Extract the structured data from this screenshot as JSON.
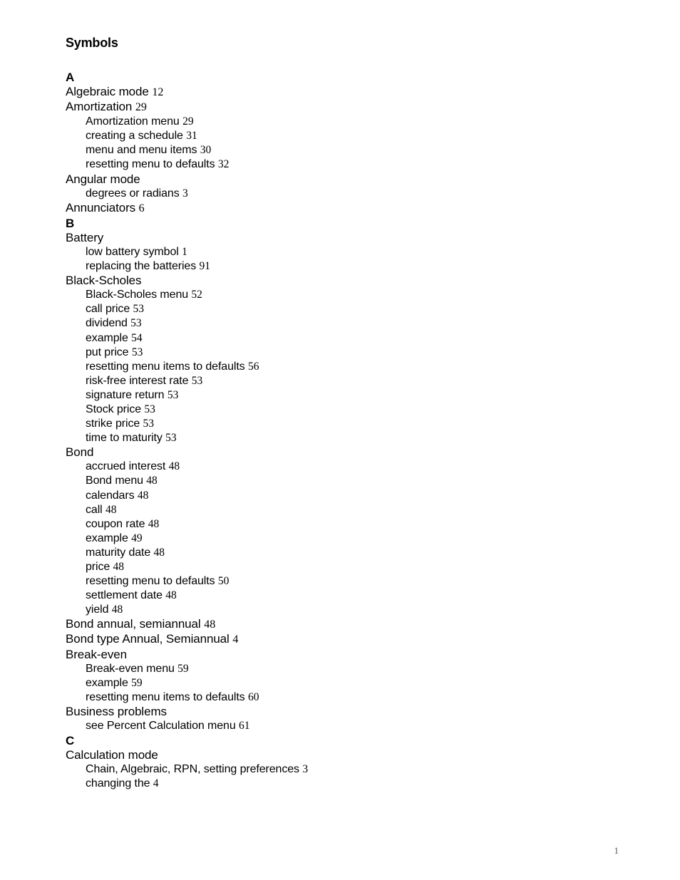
{
  "document": {
    "heading": "Symbols",
    "page_number": "1"
  },
  "index": {
    "sections": [
      {
        "letter": "A",
        "entries": [
          {
            "level": 1,
            "text": "Algebraic mode",
            "page": "12"
          },
          {
            "level": 1,
            "text": "Amortization",
            "page": "29"
          },
          {
            "level": 2,
            "text": "Amortization menu",
            "page": "29"
          },
          {
            "level": 2,
            "text": "creating a schedule",
            "page": "31"
          },
          {
            "level": 2,
            "text": "menu and menu items",
            "page": "30"
          },
          {
            "level": 2,
            "text": "resetting menu to defaults",
            "page": "32"
          },
          {
            "level": 1,
            "text": "Angular mode",
            "page": ""
          },
          {
            "level": 2,
            "text": "degrees or radians",
            "page": "3"
          },
          {
            "level": 1,
            "text": "Annunciators",
            "page": "6"
          }
        ]
      },
      {
        "letter": "B",
        "entries": [
          {
            "level": 1,
            "text": "Battery",
            "page": ""
          },
          {
            "level": 2,
            "text": "low battery symbol",
            "page": "1"
          },
          {
            "level": 2,
            "text": "replacing the batteries",
            "page": "91"
          },
          {
            "level": 1,
            "text": "Black-Scholes",
            "page": ""
          },
          {
            "level": 2,
            "text": "Black-Scholes menu",
            "page": "52"
          },
          {
            "level": 2,
            "text": "call price",
            "page": "53"
          },
          {
            "level": 2,
            "text": "dividend",
            "page": "53"
          },
          {
            "level": 2,
            "text": "example",
            "page": "54"
          },
          {
            "level": 2,
            "text": "put price",
            "page": "53"
          },
          {
            "level": 2,
            "text": "resetting menu items to defaults",
            "page": "56"
          },
          {
            "level": 2,
            "text": "risk-free interest rate",
            "page": "53"
          },
          {
            "level": 2,
            "text": "signature return",
            "page": "53"
          },
          {
            "level": 2,
            "text": "Stock price",
            "page": "53"
          },
          {
            "level": 2,
            "text": "strike price",
            "page": "53"
          },
          {
            "level": 2,
            "text": "time to maturity",
            "page": "53"
          },
          {
            "level": 1,
            "text": "Bond",
            "page": ""
          },
          {
            "level": 2,
            "text": "accrued interest",
            "page": "48"
          },
          {
            "level": 2,
            "text": "Bond menu",
            "page": "48"
          },
          {
            "level": 2,
            "text": "calendars",
            "page": "48"
          },
          {
            "level": 2,
            "text": "call",
            "page": "48"
          },
          {
            "level": 2,
            "text": "coupon rate",
            "page": "48"
          },
          {
            "level": 2,
            "text": "example",
            "page": "49"
          },
          {
            "level": 2,
            "text": "maturity date",
            "page": "48"
          },
          {
            "level": 2,
            "text": "price",
            "page": "48"
          },
          {
            "level": 2,
            "text": "resetting menu to defaults",
            "page": "50"
          },
          {
            "level": 2,
            "text": "settlement date",
            "page": "48"
          },
          {
            "level": 2,
            "text": "yield",
            "page": "48"
          },
          {
            "level": 1,
            "text": "Bond annual, semiannual",
            "page": "48"
          },
          {
            "level": 1,
            "text": "Bond type Annual, Semiannual",
            "page": "4"
          },
          {
            "level": 1,
            "text": "Break-even",
            "page": ""
          },
          {
            "level": 2,
            "text": "Break-even menu",
            "page": "59"
          },
          {
            "level": 2,
            "text": "example",
            "page": "59"
          },
          {
            "level": 2,
            "text": "resetting menu items to defaults",
            "page": "60"
          },
          {
            "level": 1,
            "text": "Business problems",
            "page": ""
          },
          {
            "level": 2,
            "text": "see Percent Calculation menu",
            "page": "61"
          }
        ]
      },
      {
        "letter": "C",
        "entries": [
          {
            "level": 1,
            "text": "Calculation mode",
            "page": ""
          },
          {
            "level": 2,
            "text": "Chain, Algebraic, RPN, setting preferences",
            "page": "3"
          },
          {
            "level": 2,
            "text": "changing the",
            "page": "4"
          }
        ]
      }
    ]
  }
}
